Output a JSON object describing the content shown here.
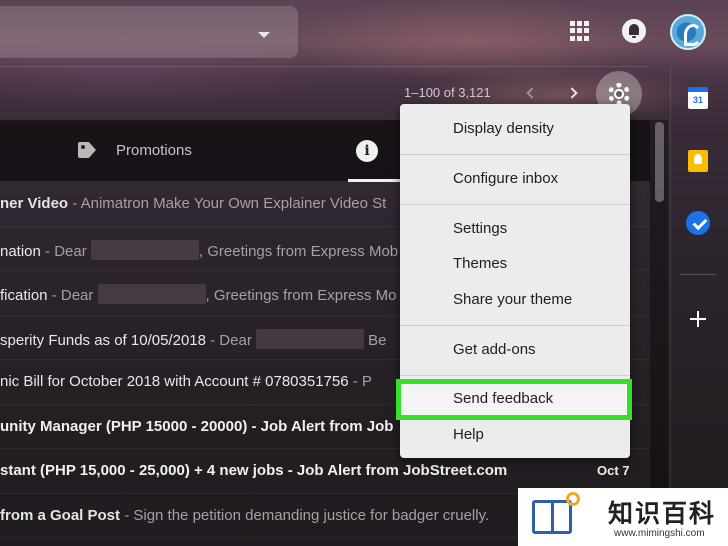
{
  "pagination": {
    "range": "1–100 of 3,121"
  },
  "tabs": [
    {
      "label": "Promotions",
      "icon": "tag-icon"
    },
    {
      "label": "",
      "icon": "info-icon"
    }
  ],
  "emails": [
    {
      "sender": "ner Video",
      "subject": "",
      "snippet": " - Animatron Make Your Own Explainer Video St",
      "bold": false
    },
    {
      "sender": "",
      "subject": "nation",
      "snippet_a": " - Dear ",
      "snippet_b": ", Greetings from Express Mob",
      "bold": false
    },
    {
      "sender": "",
      "subject": "fication",
      "snippet_a": " - Dear ",
      "snippet_b": ", Greetings from Express Mo",
      "bold": false
    },
    {
      "sender": "",
      "subject": "sperity Funds as of 10/05/2018",
      "snippet_a": " - Dear ",
      "snippet_b": " Be",
      "bold": false
    },
    {
      "sender": "",
      "subject": "nic Bill for October 2018 with Account # 0780351756",
      "snippet": " - P",
      "bold": false
    },
    {
      "sender": "",
      "subject": "unity Manager (PHP 15000 - 20000) - Job Alert from Job",
      "snippet": "",
      "bold": true
    },
    {
      "sender": "",
      "subject": "stant (PHP 15,000 - 25,000) + 4 new jobs - Job Alert from JobStreet.com",
      "snippet": "",
      "bold": true,
      "date": "Oct 7"
    },
    {
      "sender": "from a Goal Post",
      "subject": "",
      "snippet": " - Sign the petition demanding justice for badger cruelly.",
      "bold": false
    }
  ],
  "settings_menu": {
    "items": {
      "display_density": "Display density",
      "configure_inbox": "Configure inbox",
      "settings": "Settings",
      "themes": "Themes",
      "share_theme": "Share your theme",
      "get_addons": "Get add-ons",
      "send_feedback": "Send feedback",
      "help": "Help"
    },
    "highlighted": "send_feedback",
    "highlight_color": "#35e02a"
  },
  "side_panel": {
    "calendar_day": "31",
    "icons": [
      "calendar-icon",
      "keep-icon",
      "tasks-icon",
      "plus-icon"
    ]
  },
  "watermark": {
    "title": "知识百科",
    "url": "www.mimingshi.com"
  }
}
